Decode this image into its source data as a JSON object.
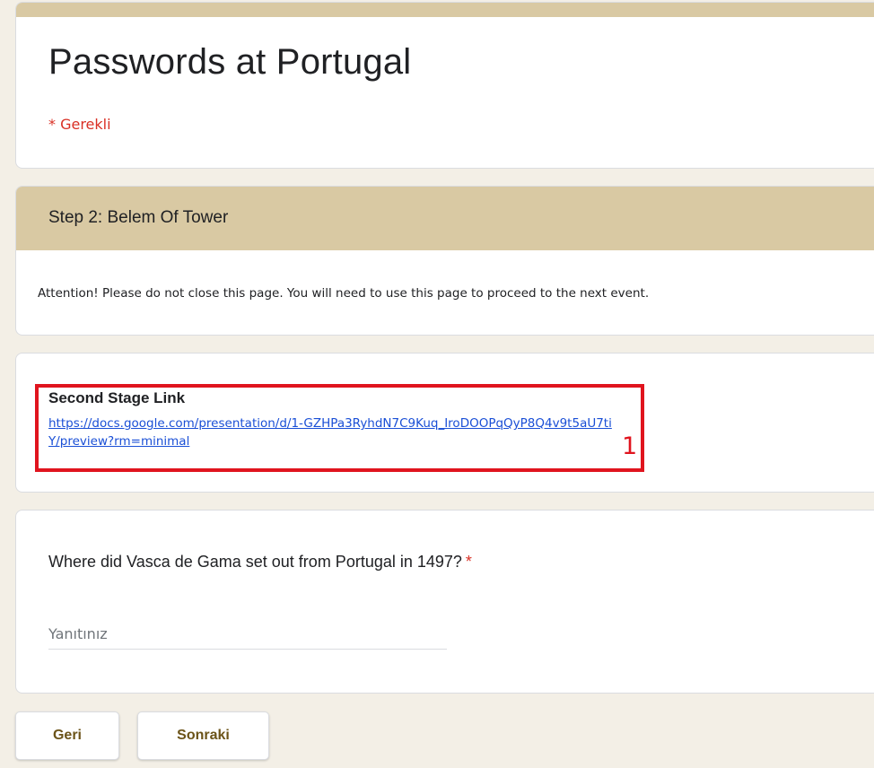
{
  "form": {
    "title": "Passwords at Portugal",
    "required_note": "* Gerekli",
    "accent_color": "#d9c9a3"
  },
  "section": {
    "title": "Step 2: Belem Of Tower",
    "description": "Attention! Please do not close this page. You will need to use this page to proceed to the next event."
  },
  "link_item": {
    "label": "Second Stage Link",
    "url": "https://docs.google.com/presentation/d/1-GZHPa3RyhdN7C9Kuq_IroDOOPqQyP8Q4v9t5aU7tiY/preview?rm=minimal",
    "marker": "1",
    "highlight_color": "#e0141e"
  },
  "question": {
    "text": "Where did Vasca de Gama set out from Portugal in 1497?",
    "required_mark": "*",
    "placeholder": "Yanıtınız",
    "value": ""
  },
  "navigation": {
    "back_label": "Geri",
    "next_label": "Sonraki"
  }
}
